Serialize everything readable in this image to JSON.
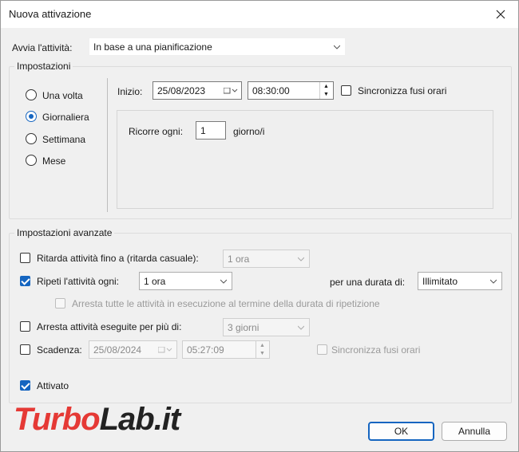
{
  "window": {
    "title": "Nuova attivazione"
  },
  "trigger": {
    "label": "Avvia l'attività:",
    "value": "In base a una pianificazione"
  },
  "settings": {
    "group_title": "Impostazioni",
    "radios": [
      {
        "label": "Una volta",
        "selected": false
      },
      {
        "label": "Giornaliera",
        "selected": true
      },
      {
        "label": "Settimana",
        "selected": false
      },
      {
        "label": "Mese",
        "selected": false
      }
    ],
    "start_label": "Inizio:",
    "start_date": "25/08/2023",
    "start_time": "08:30:00",
    "sync_label": "Sincronizza fusi orari",
    "recur_label": "Ricorre ogni:",
    "recur_value": "1",
    "recur_unit": "giorno/i"
  },
  "advanced": {
    "group_title": "Impostazioni avanzate",
    "delay": {
      "label": "Ritarda attività fino a (ritarda casuale):",
      "value": "1 ora",
      "checked": false
    },
    "repeat": {
      "label": "Ripeti l'attività ogni:",
      "value": "1 ora",
      "checked": true,
      "duration_label": "per una durata di:",
      "duration_value": "Illimitato"
    },
    "stop_all": {
      "label": "Arresta tutte le attività in esecuzione al termine della durata di ripetizione",
      "checked": false
    },
    "stop_longer": {
      "label": "Arresta attività eseguite per più di:",
      "value": "3 giorni",
      "checked": false
    },
    "expire": {
      "label": "Scadenza:",
      "date": "25/08/2024",
      "time": "05:27:09",
      "checked": false,
      "sync_label": "Sincronizza fusi orari"
    },
    "enabled": {
      "label": "Attivato",
      "checked": true
    }
  },
  "buttons": {
    "ok": "OK",
    "cancel": "Annulla"
  },
  "watermark": {
    "part1": "Turbo",
    "part2": "Lab.it"
  }
}
